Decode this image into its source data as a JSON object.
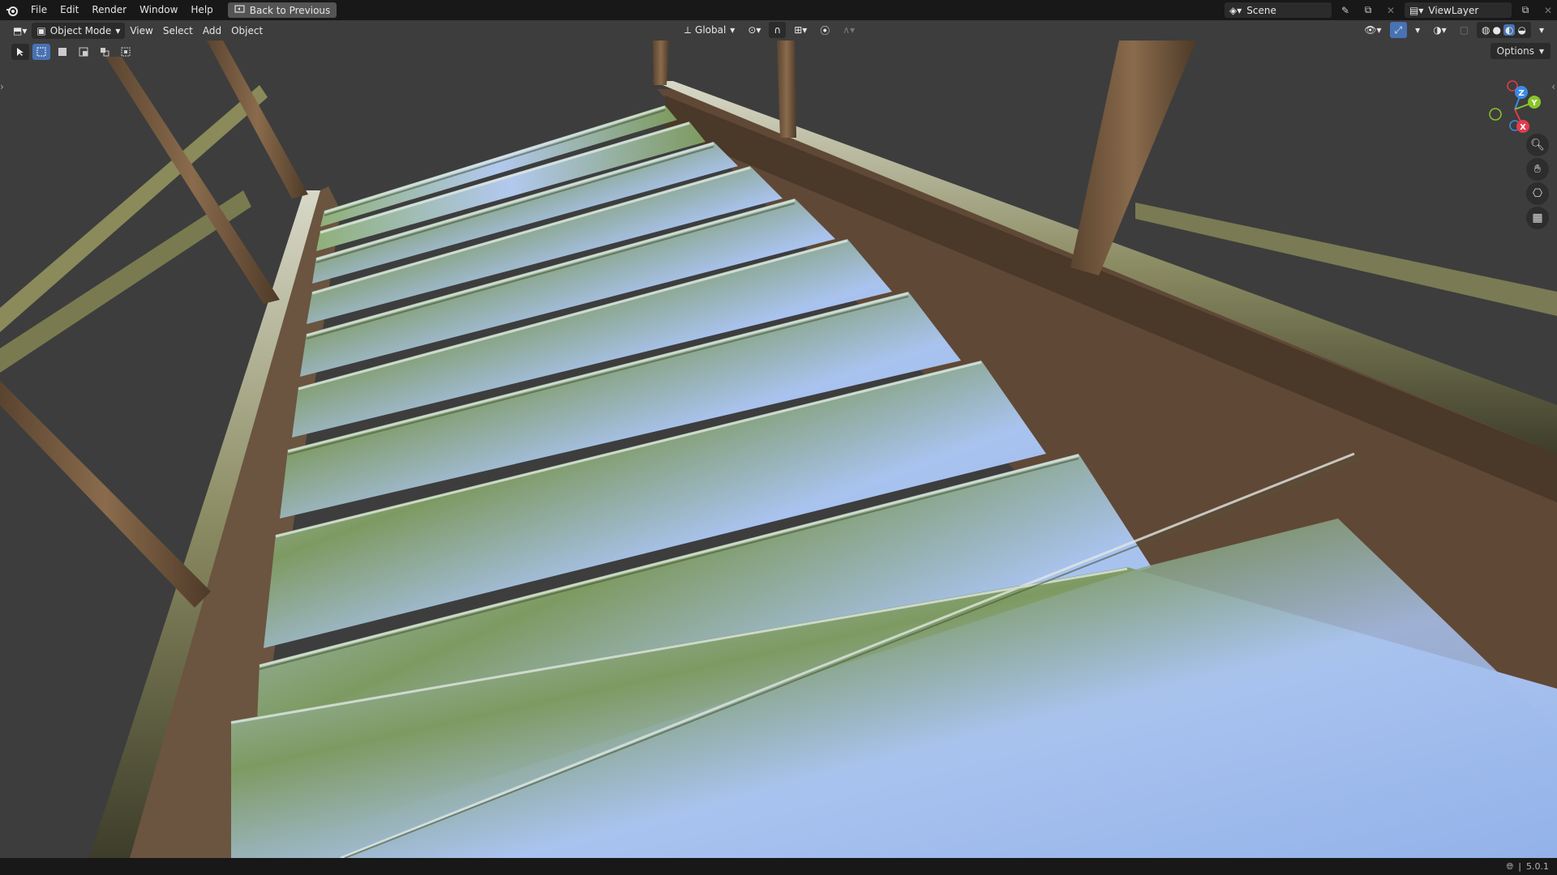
{
  "topbar": {
    "menus": [
      "File",
      "Edit",
      "Render",
      "Window",
      "Help"
    ],
    "back_button": "Back to Previous",
    "scene_name": "Scene",
    "view_layer": "ViewLayer"
  },
  "header": {
    "mode": "Object Mode",
    "menus": [
      "View",
      "Select",
      "Add",
      "Object"
    ],
    "transform_orientation": "Global",
    "options_label": "Options"
  },
  "gizmo": {
    "z": "Z",
    "y": "Y",
    "x": "X"
  },
  "status": {
    "version": "5.0.1"
  },
  "colors": {
    "accent": "#4772b3",
    "axis_x": "#e23c4b",
    "axis_y": "#89c42b",
    "axis_z": "#3b8be7"
  }
}
